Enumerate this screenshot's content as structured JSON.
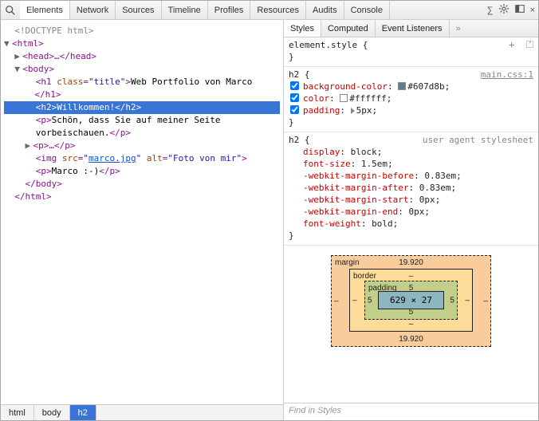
{
  "toolbar": {
    "tabs": [
      "Elements",
      "Network",
      "Sources",
      "Timeline",
      "Profiles",
      "Resources",
      "Audits",
      "Console"
    ],
    "active_tab": 0
  },
  "dom": {
    "doctype": "<!DOCTYPE html>",
    "html_open": "html",
    "head": "<head>…</head>",
    "body_open": "body",
    "h1_class_attr": "class",
    "h1_class_val": "title",
    "h1_text": "Web Portfolio von Marco",
    "h1_close": "</h1>",
    "h2_open": "<h2>",
    "h2_text": "Willkommen!",
    "h2_close": "</h2>",
    "p1_text": "Schön, dass Sie auf meiner Seite vorbeischauen.",
    "p_empty": "<p>…</p>",
    "img_src_attr": "src",
    "img_src_val": "marco.jpg",
    "img_alt_attr": "alt",
    "img_alt_val": "Foto von mir",
    "p2_text": "Marco :-)",
    "body_close": "</body>",
    "html_close": "</html>"
  },
  "breadcrumbs": [
    "html",
    "body",
    "h2"
  ],
  "styles_tabs": [
    "Styles",
    "Computed",
    "Event Listeners"
  ],
  "rules": {
    "element_style": "element.style {",
    "h2_main": {
      "selector": "h2 {",
      "source": "main.css:1",
      "props": [
        {
          "name": "background-color",
          "value": "#607d8b",
          "swatch": "#607d8b"
        },
        {
          "name": "color",
          "value": "#ffffff",
          "swatch": "#ffffff"
        },
        {
          "name": "padding",
          "value": "5px",
          "tri": true
        }
      ]
    },
    "h2_ua": {
      "selector": "h2 {",
      "source": "user agent stylesheet",
      "props": [
        {
          "name": "display",
          "value": "block"
        },
        {
          "name": "font-size",
          "value": "1.5em"
        },
        {
          "name": "-webkit-margin-before",
          "value": "0.83em"
        },
        {
          "name": "-webkit-margin-after",
          "value": "0.83em"
        },
        {
          "name": "-webkit-margin-start",
          "value": "0px"
        },
        {
          "name": "-webkit-margin-end",
          "value": "0px"
        },
        {
          "name": "font-weight",
          "value": "bold"
        }
      ]
    }
  },
  "box_model": {
    "margin_label": "margin",
    "margin_top": "19.920",
    "margin_bottom": "19.920",
    "margin_left": "–",
    "margin_right": "–",
    "border_label": "border",
    "border_val": "–",
    "padding_label": "padding",
    "padding_val": "5",
    "content": "629 × 27"
  },
  "find_placeholder": "Find in Styles"
}
